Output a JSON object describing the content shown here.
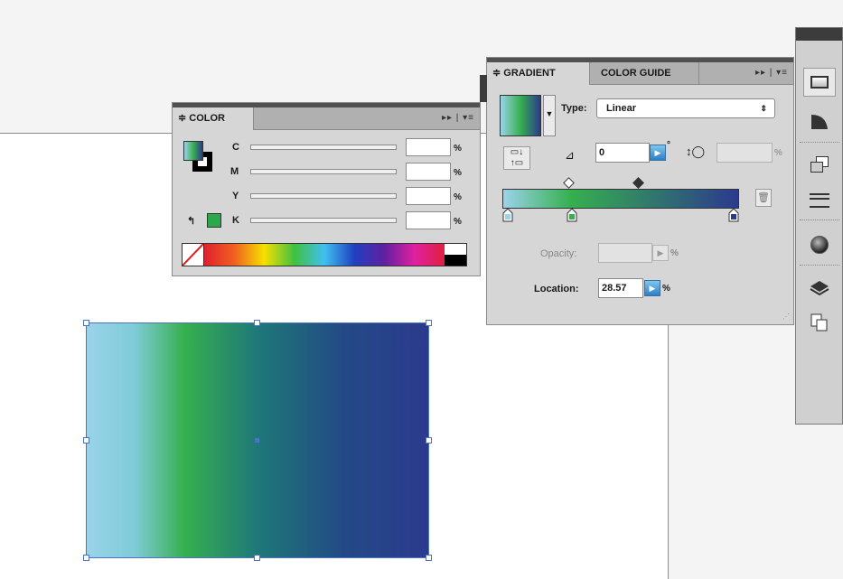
{
  "color_panel": {
    "tab_label": "≑ COLOR",
    "menu_icons": "▸▸ | ▾≡",
    "channels": [
      {
        "label": "C",
        "value": "",
        "unit": "%"
      },
      {
        "label": "M",
        "value": "",
        "unit": "%"
      },
      {
        "label": "Y",
        "value": "",
        "unit": "%"
      },
      {
        "label": "K",
        "value": "",
        "unit": "%"
      }
    ],
    "out_of_gamut_color": "#2aa84a"
  },
  "gradient_panel": {
    "tab_active": "≑ GRADIENT",
    "tab_inactive": "COLOR GUIDE",
    "menu_icons": "▸▸ | ▾≡",
    "type_label": "Type:",
    "type_value": "Linear",
    "angle_value": "0",
    "angle_unit": "°",
    "aspect_unit": "%",
    "opacity_label": "Opacity:",
    "opacity_value": "",
    "opacity_unit": "%",
    "location_label": "Location:",
    "location_value": "28.57",
    "location_unit": "%",
    "stops": [
      {
        "color": "#9ad3ea",
        "position": 0
      },
      {
        "color": "#36b04f",
        "position": 28.57
      },
      {
        "color": "#2c3a8e",
        "position": 100
      }
    ]
  },
  "colors": {
    "panel_bg": "#d6d6d6",
    "selection_blue": "#4a73c4",
    "accent_blue": "#2c7fc9"
  },
  "toolbar_icons": [
    "stroke-icon",
    "gradient-icon",
    "transparency-icon",
    "align-icon",
    "appearance-icon",
    "layers-icon",
    "artboards-icon"
  ]
}
